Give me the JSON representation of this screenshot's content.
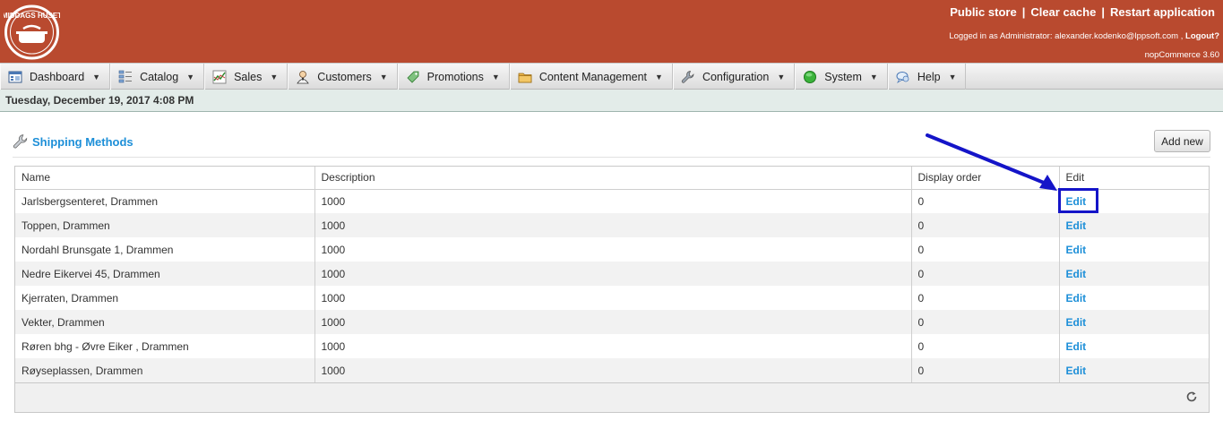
{
  "header": {
    "logo_text": "MIDDAGS HUSET",
    "links": [
      {
        "label": "Public store"
      },
      {
        "label": "Clear cache"
      },
      {
        "label": "Restart application"
      }
    ],
    "separator": "|",
    "logged_in_prefix": "Logged in as Administrator: alexander.kodenko@lppsoft.com ,",
    "logout_label": "Logout?",
    "version": "nopCommerce 3.60"
  },
  "menu": {
    "items": [
      {
        "label": "Dashboard",
        "icon": "dashboard-icon"
      },
      {
        "label": "Catalog",
        "icon": "catalog-icon"
      },
      {
        "label": "Sales",
        "icon": "sales-chart-icon"
      },
      {
        "label": "Customers",
        "icon": "customers-icon"
      },
      {
        "label": "Promotions",
        "icon": "promotions-tag-icon"
      },
      {
        "label": "Content Management",
        "icon": "folder-icon"
      },
      {
        "label": "Configuration",
        "icon": "wrench-icon"
      },
      {
        "label": "System",
        "icon": "green-circle-icon"
      },
      {
        "label": "Help",
        "icon": "help-chat-icon"
      }
    ],
    "caret": "▼"
  },
  "datebar": {
    "text": "Tuesday, December 19, 2017 4:08 PM"
  },
  "page": {
    "title": "Shipping Methods",
    "add_new_label": "Add new"
  },
  "grid": {
    "columns": [
      "Name",
      "Description",
      "Display order",
      "Edit"
    ],
    "rows": [
      {
        "name": "Jarlsbergsenteret, Drammen",
        "description": "1000",
        "display_order": "0",
        "edit": "Edit"
      },
      {
        "name": "Toppen, Drammen",
        "description": "1000",
        "display_order": "0",
        "edit": "Edit"
      },
      {
        "name": "Nordahl Brunsgate 1, Drammen",
        "description": "1000",
        "display_order": "0",
        "edit": "Edit"
      },
      {
        "name": "Nedre Eikervei 45, Drammen",
        "description": "1000",
        "display_order": "0",
        "edit": "Edit"
      },
      {
        "name": "Kjerraten, Drammen",
        "description": "1000",
        "display_order": "0",
        "edit": "Edit"
      },
      {
        "name": "Vekter, Drammen",
        "description": "1000",
        "display_order": "0",
        "edit": "Edit"
      },
      {
        "name": "Røren bhg - Øvre Eiker , Drammen",
        "description": "1000",
        "display_order": "0",
        "edit": "Edit"
      },
      {
        "name": "Røyseplassen, Drammen",
        "description": "1000",
        "display_order": "0",
        "edit": "Edit"
      }
    ],
    "refresh_icon": "refresh-icon"
  },
  "colors": {
    "header_bg": "#b94a2f",
    "link_blue": "#1d8fd8",
    "annotation_blue": "#1414c8",
    "datebar_bg": "#e3ece9"
  }
}
